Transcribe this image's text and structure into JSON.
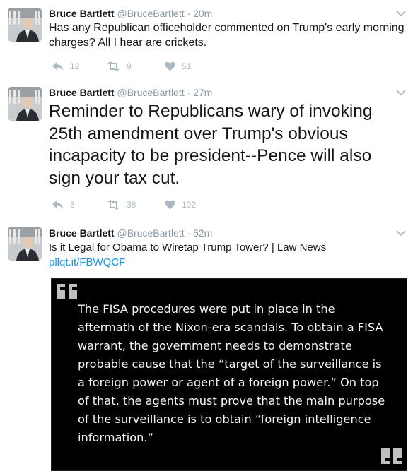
{
  "tweets": [
    {
      "name": "Bruce Bartlett",
      "handle": "@BruceBartlett",
      "separator": "·",
      "time": "20m",
      "text": "Has any Republican officeholder commented on Trump's early morning charges? All I hear are crickets.",
      "replies": "12",
      "retweets": "9",
      "likes": "51"
    },
    {
      "name": "Bruce Bartlett",
      "handle": "@BruceBartlett",
      "separator": "·",
      "time": "27m",
      "text": "Reminder to Republicans wary of invoking 25th amendment over Trump's obvious incapacity to be president--Pence will also sign your tax cut.",
      "replies": "6",
      "retweets": "38",
      "likes": "102"
    },
    {
      "name": "Bruce Bartlett",
      "handle": "@BruceBartlett",
      "separator": "·",
      "time": "52m",
      "text": "Is it Legal for Obama to Wiretap Trump Tower? | Law News",
      "link": "pllqt.it/FBWQCF",
      "quote": "The FISA procedures were put in place in the aftermath of the Nixon-era scandals. To obtain a FISA warrant, the government needs to demonstrate probable cause that the “target of the surveillance is a foreign power or agent of a foreign power.” On top of that, the agents must prove that the main purpose of the surveillance is to obtain “foreign intelligence information.”"
    }
  ],
  "icons": {
    "reply": "reply-icon",
    "retweet": "retweet-icon",
    "like": "heart-icon",
    "menu": "chevron-down-icon",
    "open_quote": "open-quote-icon",
    "close_quote": "close-quote-icon"
  },
  "colors": {
    "link": "#1b95e0",
    "meta": "#8899a6",
    "action": "#aab8c2",
    "quote_bg": "#000000"
  }
}
